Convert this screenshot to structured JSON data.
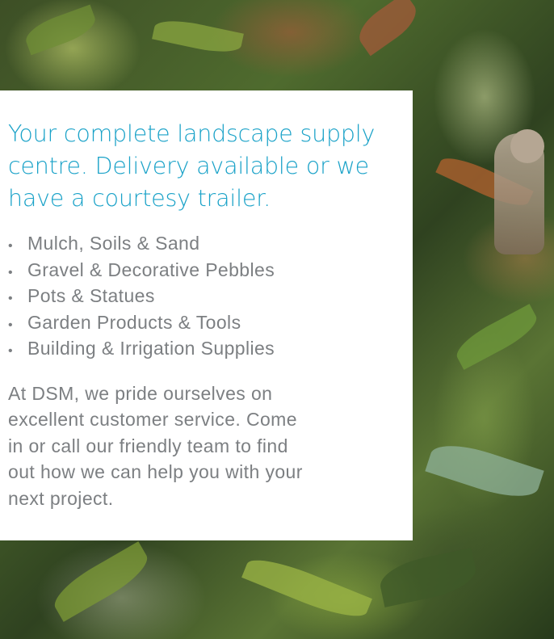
{
  "headline": {
    "lines": [
      "Your complete landscape supply",
      "centre. Delivery available or we",
      "have a courtesy trailer."
    ]
  },
  "products": {
    "bullet": "•",
    "items": [
      "Mulch, Soils & Sand",
      "Gravel & Decorative Pebbles",
      "Pots & Statues",
      "Garden Products & Tools",
      "Building & Irrigation Supplies"
    ]
  },
  "intro": {
    "lines": [
      "At DSM, we pride ourselves on",
      "excellent customer service. Come",
      "in or call our friendly team to find",
      "out how we can help you with your",
      "next project."
    ]
  },
  "colors": {
    "headline": "#1aa2c8",
    "body_text": "#7c7f82",
    "card_background": "#ffffff"
  }
}
